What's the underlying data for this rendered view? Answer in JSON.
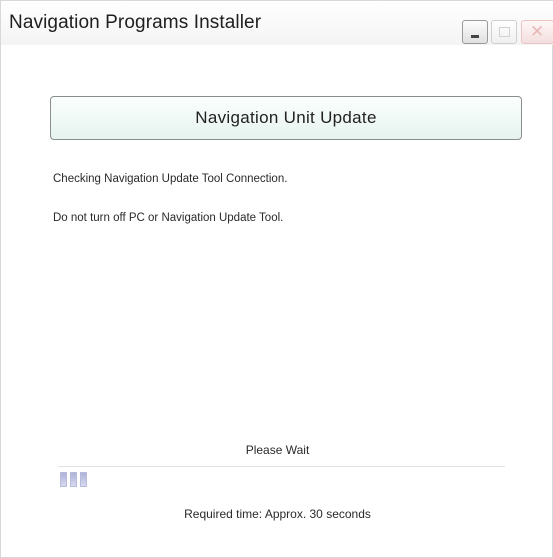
{
  "window": {
    "title": "Navigation Programs Installer",
    "controls": [
      "minimize-icon",
      "maximize-icon",
      "close-icon"
    ]
  },
  "banner": {
    "title": "Navigation Unit Update"
  },
  "messages": {
    "status": "Checking Navigation Update Tool Connection.",
    "warning": "Do not turn off PC or Navigation Update Tool."
  },
  "progress": {
    "label": "Please Wait",
    "segments": 3,
    "required_time": "Required time: Approx. 30 seconds"
  },
  "colors": {
    "banner_fill": "#e6f3ef",
    "progress_fill": "#aeb3d8"
  }
}
